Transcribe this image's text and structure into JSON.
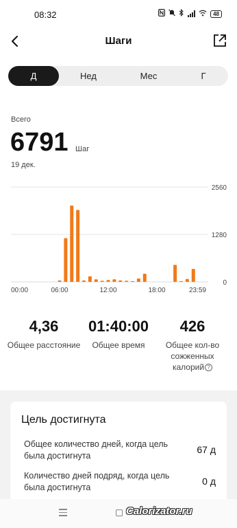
{
  "status_bar": {
    "time": "08:32",
    "battery": "48",
    "icons": [
      "nfc-icon",
      "mute-icon",
      "bluetooth-icon",
      "signal-icon",
      "wifi-icon",
      "battery-icon"
    ]
  },
  "header": {
    "title": "Шаги",
    "back_icon": "chevron-left-icon",
    "share_icon": "share-external-icon"
  },
  "tabs": [
    {
      "label": "Д",
      "active": true
    },
    {
      "label": "Нед",
      "active": false
    },
    {
      "label": "Мес",
      "active": false
    },
    {
      "label": "Г",
      "active": false
    }
  ],
  "summary": {
    "label": "Всего",
    "value": "6791",
    "unit": "Шаг",
    "date": "19 дек."
  },
  "chart_data": {
    "type": "bar",
    "x_ticks": [
      "00:00",
      "06:00",
      "12:00",
      "18:00",
      "23:59"
    ],
    "y_ticks": [
      "2560",
      "1280",
      "0"
    ],
    "ylim": [
      0,
      2560
    ],
    "bar_color": "#f07a1a",
    "x_hours": [
      6,
      6.75,
      7.5,
      8.25,
      9,
      9.75,
      10.5,
      11.25,
      12,
      12.75,
      13.5,
      14.25,
      15,
      15.75,
      16.5,
      17.25,
      18,
      18.75,
      19.5,
      20.25,
      21,
      21.75,
      22.5,
      23.25
    ],
    "values": [
      40,
      1180,
      2060,
      1940,
      40,
      150,
      70,
      30,
      50,
      70,
      40,
      30,
      20,
      90,
      220,
      0,
      0,
      0,
      0,
      460,
      20,
      80,
      350,
      0
    ]
  },
  "stats": [
    {
      "value": "4,36",
      "label": "Общее расстояние"
    },
    {
      "value": "01:40:00",
      "label": "Общее время"
    },
    {
      "value": "426",
      "label_line1": "Общее кол-во",
      "label_line2": "сожженных",
      "label_line3": "калорий"
    }
  ],
  "goal_card": {
    "title": "Цель достигнута",
    "rows": [
      {
        "label": "Общее количество дней, когда цель была достигнута",
        "value": "67 д"
      },
      {
        "label": "Количество дней подряд, когда цель была достигнута",
        "value": "0 д"
      }
    ]
  },
  "watermark": "Calorizator.ru",
  "colors": {
    "accent": "#f07a1a",
    "active_tab": "#1a1a1a",
    "tabs_bg": "#eeeeee",
    "page_bg": "#f2f2f2"
  }
}
